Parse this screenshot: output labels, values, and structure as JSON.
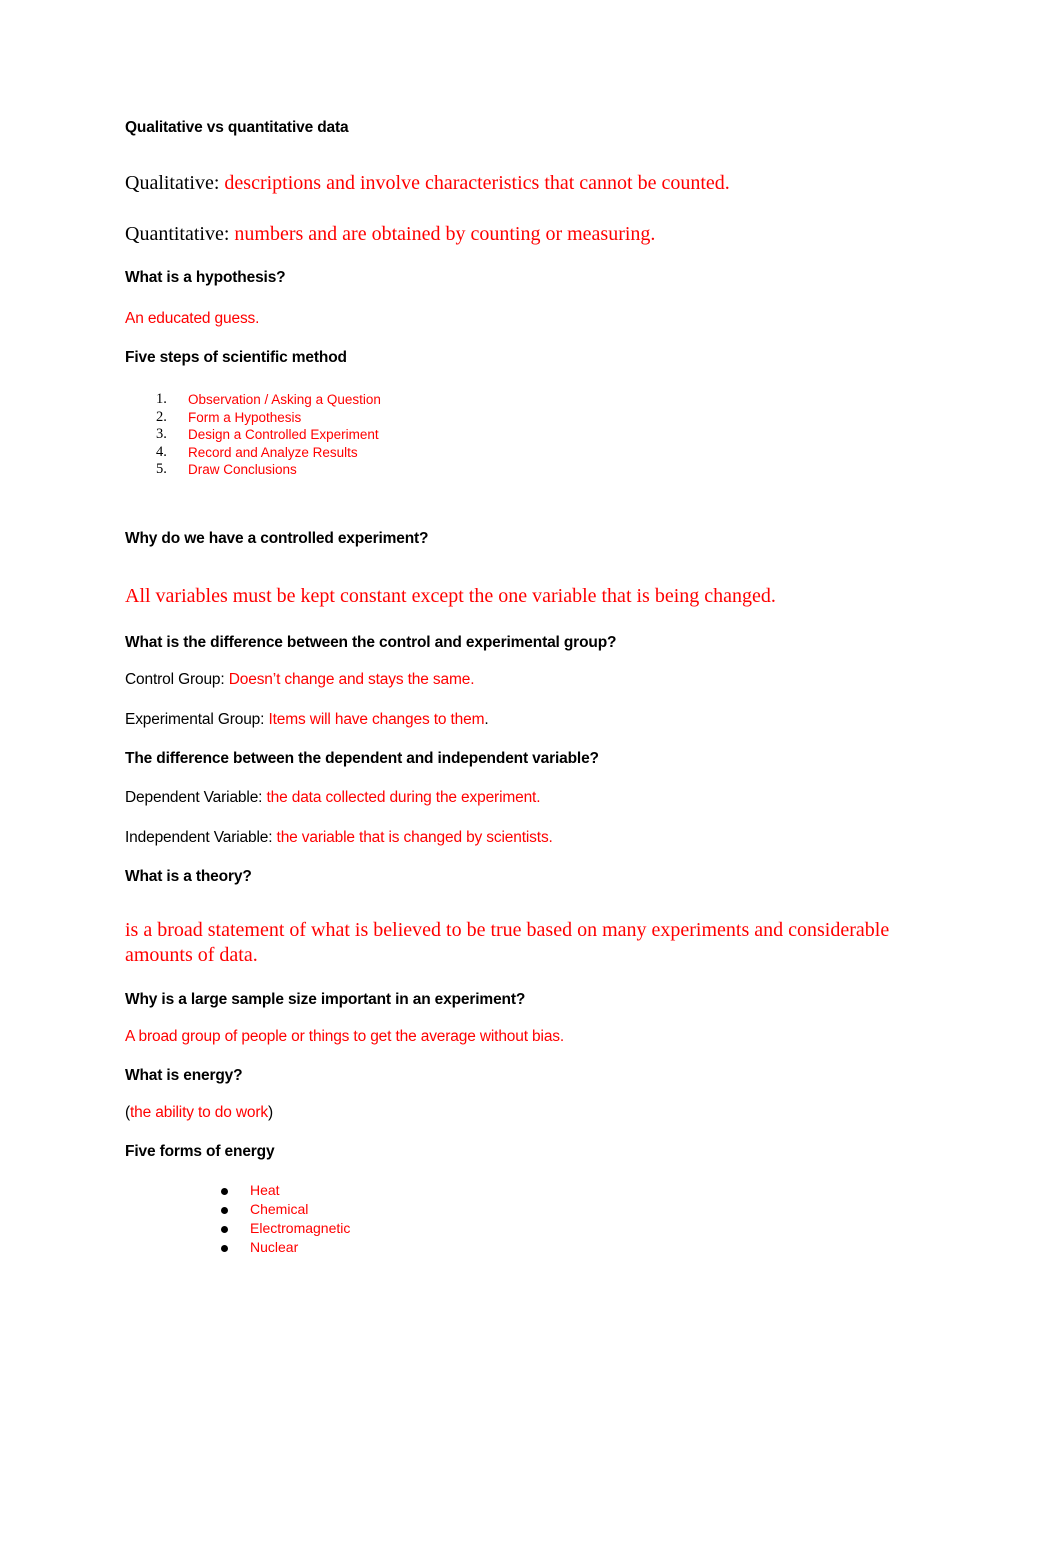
{
  "document": {
    "sections": [
      {
        "heading": "Qualitative vs quantitative data",
        "qualitative_label": "Qualitative: ",
        "qualitative_answer": "descriptions and involve characteristics that cannot be counted.",
        "quantitative_label": "Quantitative: ",
        "quantitative_answer": "numbers and are obtained by counting or measuring."
      },
      {
        "heading": "What is a hypothesis?",
        "answer": "An educated guess."
      },
      {
        "heading": "Five steps of scientific method",
        "steps": [
          {
            "marker": "1.",
            "label": "Observation / Asking a Question"
          },
          {
            "marker": "2.",
            "label": "Form a Hypothesis"
          },
          {
            "marker": "3.",
            "label": "Design a Controlled Experiment"
          },
          {
            "marker": "4.",
            "label": "Record and Analyze Results"
          },
          {
            "marker": "5.",
            "label": "Draw Conclusions"
          }
        ]
      },
      {
        "heading": "Why do we have a controlled experiment?",
        "answer": "All variables must be kept constant except the one variable that is being changed."
      },
      {
        "heading": "What is the difference between the control and experimental group?",
        "control_label": "Control Group: ",
        "control_answer": "Doesn’t change and stays the same.",
        "experimental_label": "Experimental Group: ",
        "experimental_answer": "Items will have changes to them",
        "experimental_trailing": "."
      },
      {
        "heading": "The difference between the dependent and independent variable?",
        "dependent_label": "Dependent Variable: ",
        "dependent_answer": "the data collected during the experiment.",
        "independent_label": "Independent Variable: ",
        "independent_answer": "the variable that is changed by scientists."
      },
      {
        "heading": "What is a theory?",
        "answer": "is a broad statement of what is believed to be true based on many experiments and considerable amounts of data."
      },
      {
        "heading": "Why is a large sample size important in an experiment?",
        "answer": "A broad group of people or things to get the average without bias."
      },
      {
        "heading": "What is energy?",
        "open_paren": "(",
        "answer": "the ability to do work",
        "close_paren": ")"
      },
      {
        "heading": "Five forms of energy",
        "forms": [
          {
            "label": "Heat"
          },
          {
            "label": "Chemical"
          },
          {
            "label": "Electromagnetic"
          },
          {
            "label": "Nuclear"
          }
        ]
      }
    ]
  },
  "colors": {
    "answer_red": "#FF0000",
    "text_black": "#000000",
    "page_background": "#FFFFFF"
  }
}
